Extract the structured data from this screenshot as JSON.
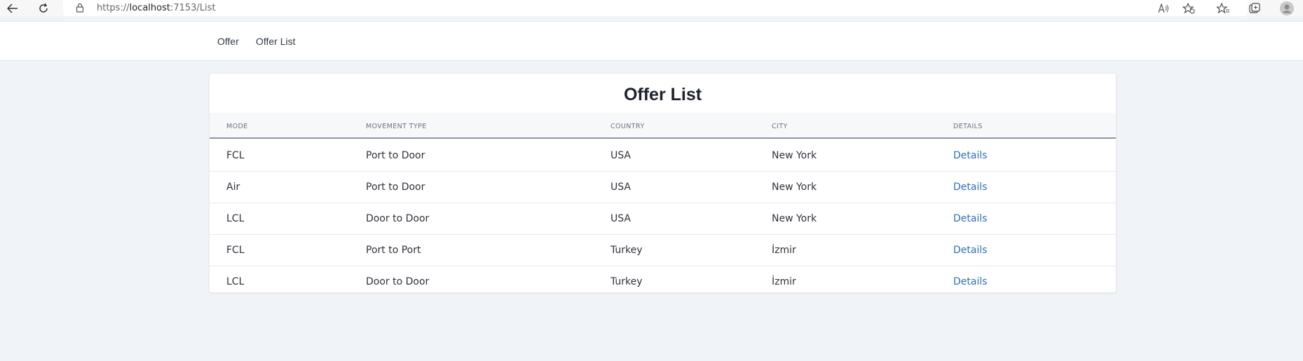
{
  "browser": {
    "url_prefix": "https://",
    "url_host": "localhost",
    "url_rest": ":7153/List"
  },
  "navbar": {
    "links": [
      "Offer",
      "Offer List"
    ]
  },
  "page": {
    "title": "Offer List"
  },
  "table": {
    "headers": [
      "MODE",
      "MOVEMENT TYPE",
      "COUNTRY",
      "CITY",
      "DETAILS"
    ],
    "rows": [
      [
        "FCL",
        "Port to Door",
        "USA",
        "New York",
        "Details"
      ],
      [
        "Air",
        "Port to Door",
        "USA",
        "New York",
        "Details"
      ],
      [
        "LCL",
        "Door to Door",
        "USA",
        "New York",
        "Details"
      ],
      [
        "FCL",
        "Port to Port",
        "Turkey",
        "İzmir",
        "Details"
      ],
      [
        "LCL",
        "Door to Door",
        "Turkey",
        "İzmir",
        "Details"
      ]
    ]
  },
  "colors": {
    "link": "#2f6fbd",
    "background": "#f0f3f7"
  }
}
